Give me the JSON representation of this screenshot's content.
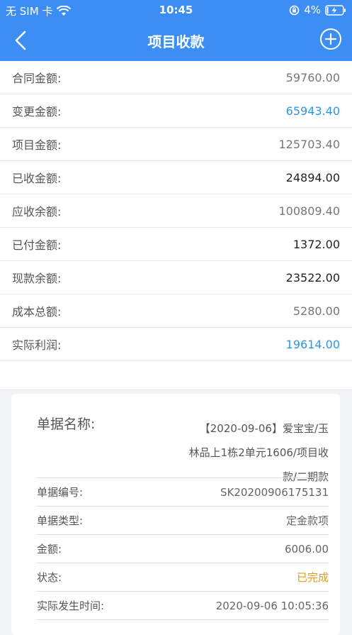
{
  "status_bar": {
    "carrier": "无 SIM 卡",
    "time": "10:45",
    "battery": "4%"
  },
  "header": {
    "title": "项目收款"
  },
  "summary": [
    {
      "label": "合同金额:",
      "value": "59760.00",
      "tone": "gray"
    },
    {
      "label": "变更金额:",
      "value": "65943.40",
      "tone": "blue"
    },
    {
      "label": "项目金额:",
      "value": "125703.40",
      "tone": "gray"
    },
    {
      "label": "已收金额:",
      "value": "24894.00",
      "tone": "dark"
    },
    {
      "label": "应收余额:",
      "value": "100809.40",
      "tone": "gray"
    },
    {
      "label": "已付金额:",
      "value": "1372.00",
      "tone": "dark"
    },
    {
      "label": "现款余额:",
      "value": "23522.00",
      "tone": "dark"
    },
    {
      "label": "成本总额:",
      "value": "5280.00",
      "tone": "gray"
    },
    {
      "label": "实际利润:",
      "value": "19614.00",
      "tone": "blue"
    }
  ],
  "document": {
    "name_label": "单据名称:",
    "name_lines": [
      "【2020-09-06】爱宝宝/玉",
      "林品上1栋2单元1606/项目收",
      "款/二期款"
    ],
    "rows": [
      {
        "label": "单据编号:",
        "value": "SK20200906175131",
        "tone": "gray"
      },
      {
        "label": "单据类型:",
        "value": "定金款项",
        "tone": "gray"
      },
      {
        "label": "金额:",
        "value": "6006.00",
        "tone": "gray"
      },
      {
        "label": "状态:",
        "value": "已完成",
        "tone": "orange"
      },
      {
        "label": "实际发生时间:",
        "value": "2020-09-06 10:05:36",
        "tone": "gray"
      }
    ]
  },
  "colors": {
    "header_blue": "#3d8ef4",
    "value_blue": "#2f95ec",
    "status_orange": "#e39b16"
  }
}
